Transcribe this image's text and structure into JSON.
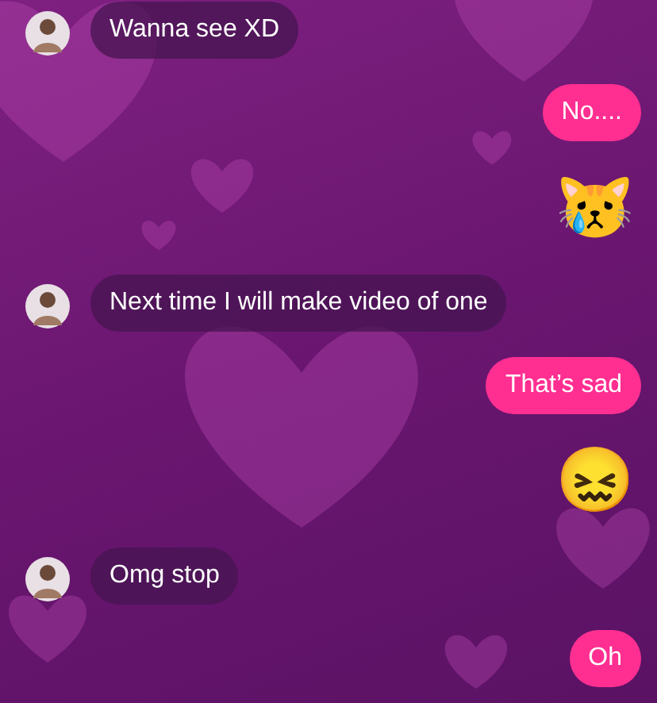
{
  "messages": [
    {
      "kind": "incoming",
      "text": "Wanna see XD"
    },
    {
      "kind": "outgoing",
      "text": "No...."
    },
    {
      "kind": "emoji",
      "text": "😿"
    },
    {
      "kind": "incoming",
      "text": "Next time I will make video of one"
    },
    {
      "kind": "outgoing",
      "text": "That’s sad"
    },
    {
      "kind": "emoji",
      "text": "😖"
    },
    {
      "kind": "incoming",
      "text": "Omg stop"
    },
    {
      "kind": "outgoing",
      "text": "Oh"
    }
  ]
}
